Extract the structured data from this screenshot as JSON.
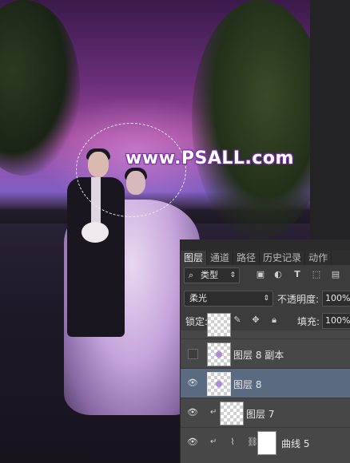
{
  "watermark": "www.PSALL.com",
  "panel": {
    "tabs": [
      {
        "label": "图层",
        "active": true
      },
      {
        "label": "通道",
        "active": false
      },
      {
        "label": "路径",
        "active": false
      },
      {
        "label": "历史记录",
        "active": false
      },
      {
        "label": "动作",
        "active": false
      }
    ],
    "filter": {
      "icon": "search-icon",
      "label": "类型"
    },
    "filter_icons": [
      "image-filter-icon",
      "adjustment-filter-icon",
      "type-filter-icon",
      "shape-filter-icon",
      "smart-object-filter-icon"
    ],
    "blend_mode": "柔光",
    "opacity_label": "不透明度:",
    "opacity_value": "100%",
    "lock_label": "锁定:",
    "lock_icons": [
      "lock-transparent-icon",
      "lock-image-icon",
      "lock-position-icon",
      "lock-all-icon"
    ],
    "fill_label": "填充:",
    "fill_value": "100%",
    "layers": [
      {
        "name": "图层 8 副本",
        "visible": false,
        "selected": false
      },
      {
        "name": "图层 8",
        "visible": true,
        "selected": true
      },
      {
        "name": "图层 7",
        "visible": true,
        "selected": false,
        "clipped": true
      },
      {
        "name": "曲线 5",
        "visible": true,
        "selected": false,
        "clipped": true,
        "adjustment": "curves-icon"
      }
    ]
  },
  "colors": {
    "panel_bg": "#3c3c3c",
    "selected_layer": "#5a6a80",
    "watermark_outline": "#7a2fa8"
  }
}
